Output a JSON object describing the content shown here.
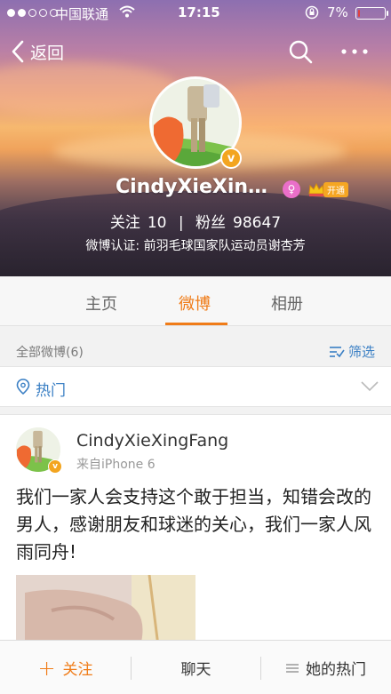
{
  "status_bar": {
    "carrier": "中国联通",
    "time": "17:15",
    "battery_percent": "7%",
    "battery_level": 0.07,
    "signal_bars_filled": 2,
    "signal_bars_total": 5
  },
  "nav": {
    "back_label": "返回",
    "search_icon": "search-icon",
    "more_icon": "more-icon"
  },
  "profile": {
    "name": "CindyXieXing...",
    "gender_icon": "female-icon",
    "vip_label": "开通",
    "follow_label": "关注",
    "follow_count": "10",
    "separator": "|",
    "fans_label": "粉丝",
    "fans_count": "98647",
    "verification": "微博认证: 前羽毛球国家队运动员谢杏芳",
    "verified_badge": "v"
  },
  "tabs": [
    {
      "label": "主页",
      "active": false
    },
    {
      "label": "微博",
      "active": true
    },
    {
      "label": "相册",
      "active": false
    }
  ],
  "filter": {
    "all_label": "全部微博(6)",
    "filter_label": "筛选"
  },
  "hot": {
    "label": "热门"
  },
  "post": {
    "author": "CindyXieXingFang",
    "source": "来自iPhone 6",
    "verified_badge": "v",
    "text": "我们一家人会支持这个敢于担当，知错会改的男人，感谢朋友和球迷的关心，我们一家人风雨同舟!"
  },
  "bottom_bar": {
    "follow_plus": "+",
    "follow_label": "关注",
    "chat_label": "聊天",
    "hot_label": "她的热门"
  },
  "colors": {
    "accent": "#f07c18",
    "link_blue": "#3a7fc4",
    "badge_orange": "#f3a51f"
  }
}
